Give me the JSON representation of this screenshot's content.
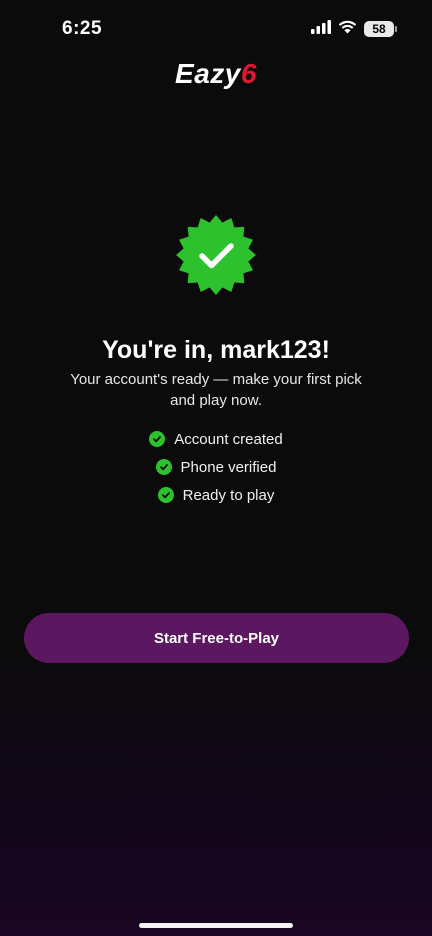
{
  "status_bar": {
    "time": "6:25",
    "battery_level": "58",
    "icons": [
      "signal-icon",
      "wifi-icon",
      "battery-icon"
    ]
  },
  "logo": {
    "text_main": "Eazy",
    "text_accent": "6",
    "accent_color": "#e0182d"
  },
  "badge": {
    "icon": "verified-check-badge-icon",
    "color": "#2ec12e"
  },
  "headline": "You're in, mark123!",
  "subtitle": "Your account's ready — make your first pick and play now.",
  "checklist": [
    {
      "label": "Account created",
      "icon": "check-circle-icon"
    },
    {
      "label": "Phone verified",
      "icon": "check-circle-icon"
    },
    {
      "label": "Ready to play",
      "icon": "check-circle-icon"
    }
  ],
  "cta": {
    "label": "Start Free-to-Play",
    "color": "#5b1760"
  }
}
